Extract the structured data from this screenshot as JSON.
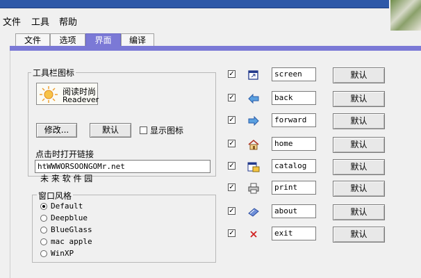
{
  "menu": {
    "file": "文件",
    "tools": "工具",
    "help": "帮助"
  },
  "tabs": [
    {
      "label": "文件",
      "active": false
    },
    {
      "label": "选项",
      "active": false
    },
    {
      "label": "界面",
      "active": true
    },
    {
      "label": "编译",
      "active": false
    }
  ],
  "toolbar_icon_group": {
    "title": "工具栏图标",
    "logo": {
      "name_cn": "阅读时尚",
      "name_en": "Readever",
      "icon": "sun-icon"
    },
    "modify_button": "修改...",
    "default_button": "默认",
    "show_icon_label": "显示图标",
    "show_icon_checked": false
  },
  "link": {
    "label": "点击时打开链接",
    "value": "htWWWORSOONGOMr.net",
    "caption": "未 来 软 件 园"
  },
  "window_style": {
    "title": "窗口风格",
    "options": [
      {
        "label": "Default",
        "selected": true
      },
      {
        "label": "Deepblue",
        "selected": false
      },
      {
        "label": "BlueGlass",
        "selected": false
      },
      {
        "label": "mac apple",
        "selected": false
      },
      {
        "label": "WinXP",
        "selected": false
      }
    ]
  },
  "toolbar_items": [
    {
      "checked": true,
      "icon": "screen-window-icon",
      "value": "screen",
      "default_label": "默认"
    },
    {
      "checked": true,
      "icon": "back-arrow-icon",
      "value": "back",
      "default_label": "默认"
    },
    {
      "checked": true,
      "icon": "forward-arrow-icon",
      "value": "forward",
      "default_label": "默认"
    },
    {
      "checked": true,
      "icon": "home-icon",
      "value": "home",
      "default_label": "默认"
    },
    {
      "checked": true,
      "icon": "catalog-icon",
      "value": "catalog",
      "default_label": "默认"
    },
    {
      "checked": true,
      "icon": "printer-icon",
      "value": "print",
      "default_label": "默认"
    },
    {
      "checked": true,
      "icon": "about-icon",
      "value": "about",
      "default_label": "默认"
    },
    {
      "checked": true,
      "icon": "exit-x-icon",
      "value": "exit",
      "default_label": "默认"
    }
  ],
  "colors": {
    "accent": "#7b79d6",
    "titlebar": "#2f59a8"
  }
}
